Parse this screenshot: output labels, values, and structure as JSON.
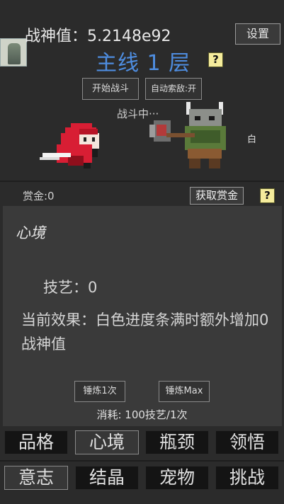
{
  "header": {
    "power_label": "战神值：",
    "power_value": "5.2148e92",
    "settings_label": "设置",
    "stage_label": "主线 1 层",
    "help_label": "?"
  },
  "battle": {
    "start_button": "开始战斗",
    "auto_button": "自动索敌:开",
    "status_text": "战斗中···",
    "enemy_tag": "白"
  },
  "bounty": {
    "label": "赏金:0",
    "claim_button": "获取赏金",
    "help_label": "?"
  },
  "panel": {
    "title": "心境",
    "skill_text": "技艺：0",
    "effect_text": "当前效果：白色进度条满时额外增加0战神值",
    "train_once_button": "锤炼1次",
    "train_max_button": "锤炼Max",
    "cost_text": "消耗: 100技艺/1次"
  },
  "tabs_row1": [
    "品格",
    "心境",
    "瓶颈",
    "领悟"
  ],
  "tabs_row2": [
    "意志",
    "结晶",
    "宠物",
    "挑战"
  ],
  "colors": {
    "stage_blue": "#4e8de0",
    "help_yellow": "#f5ec9c",
    "hero_red": "#d81e34"
  }
}
